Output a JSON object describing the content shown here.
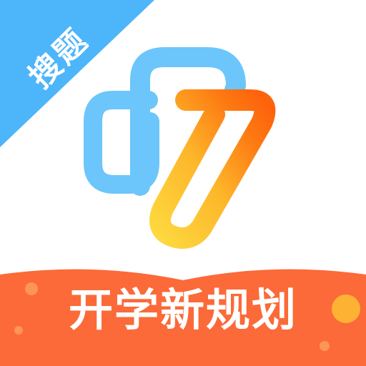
{
  "app_icon": {
    "corner_badge_text": "搜题",
    "banner_text": "开学新规划",
    "colors": {
      "background": "#ffffff",
      "badge": "#4db5fa",
      "banner": "#fb6a38",
      "loop_blue": "#6cc6fb",
      "seven_orange": "#fd6a10",
      "seven_yellow": "#fdd23a",
      "accent_dot": "#fdb234"
    },
    "icons": [
      "logo-mark-icon",
      "corner-ribbon-icon",
      "banner-icon"
    ]
  }
}
